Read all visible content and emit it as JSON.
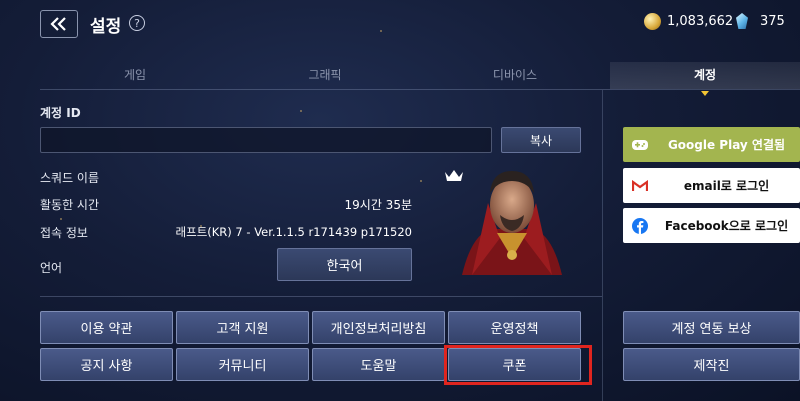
{
  "header": {
    "title": "설정",
    "back_icon": "double-chevron-left-icon",
    "gold_amount": "1,083,662",
    "gem_amount": "375"
  },
  "tabs": [
    {
      "label": "게임",
      "active": false
    },
    {
      "label": "그래픽",
      "active": false
    },
    {
      "label": "디바이스",
      "active": false
    },
    {
      "label": "계정",
      "active": true
    }
  ],
  "account": {
    "id_label": "계정 ID",
    "id_value": "",
    "copy_label": "복사",
    "squad_label": "스쿼드 이름",
    "playtime_label": "활동한 시간",
    "playtime_value": "19시간 35분",
    "connection_label": "접속 정보",
    "connection_value": "래프트(KR) 7 - Ver.1.1.5 r171439 p171520",
    "language_label": "언어",
    "language_value": "한국어"
  },
  "menu_buttons": [
    [
      "이용 약관",
      "고객 지원",
      "개인정보처리방침",
      "운영정책"
    ],
    [
      "공지 사항",
      "커뮤니티",
      "도움말",
      "쿠폰"
    ]
  ],
  "login_buttons": {
    "google": "Google Play 연결됨",
    "email": "email로 로그인",
    "facebook": "Facebook으로 로그인"
  },
  "side_buttons": {
    "reward": "계정 연동 보상",
    "credits": "제작진"
  },
  "colors": {
    "google_button": "#a3b54f",
    "highlight": "#e0251f",
    "active_tab_marker": "#f3c534"
  }
}
